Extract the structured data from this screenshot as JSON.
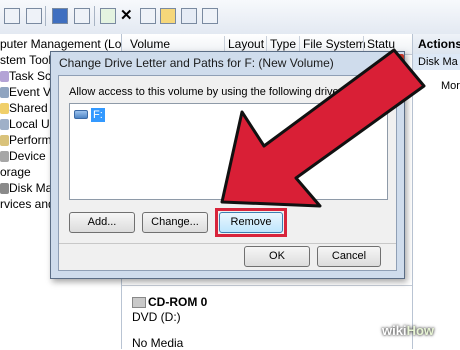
{
  "tree": {
    "items": [
      "puter Management (Local",
      "stem Tools",
      "Task Sche",
      "Event View",
      "Shared Fo",
      "Local Use",
      "Performa",
      "Device M",
      "orage",
      "Disk Man",
      "rvices and"
    ]
  },
  "list_header": {
    "columns": [
      "Volume",
      "Layout",
      "Type",
      "File System",
      "Statu"
    ]
  },
  "actions": {
    "title": "Actions",
    "selected": "Disk Ma",
    "more": "Mor"
  },
  "disk_panel": {
    "disk_name": "CD-ROM 0",
    "disk_type": "DVD (D:)",
    "media": "No Media"
  },
  "dialog": {
    "title": "Change Drive Letter and Paths for F: (New Volume)",
    "description": "Allow access to this volume by using the following drive le",
    "drive_item": "F:",
    "add_button": "Add...",
    "change_button": "Change...",
    "remove_button": "Remove",
    "ok_button": "OK",
    "cancel_button": "Cancel"
  },
  "watermark": {
    "wiki": "wiki",
    "how": "How"
  },
  "colors": {
    "arrow": "#d91f36",
    "highlight": "#d8243b",
    "selection": "#3399ff"
  }
}
